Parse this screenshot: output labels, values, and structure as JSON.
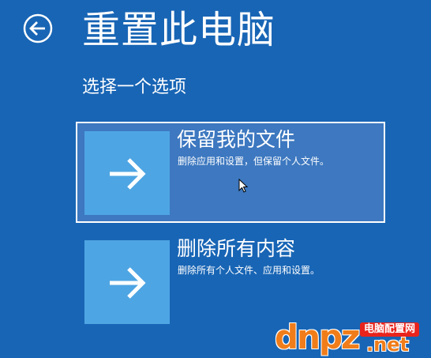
{
  "page": {
    "title": "重置此电脑",
    "subtitle": "选择一个选项",
    "back_icon": "back-arrow-circle-icon"
  },
  "options": [
    {
      "title": "保留我的文件",
      "description": "删除应用和设置，但保留个人文件。",
      "icon": "arrow-right-icon",
      "selected": true
    },
    {
      "title": "删除所有内容",
      "description": "删除所有个人文件、应用和设置。",
      "icon": "arrow-right-icon",
      "selected": false
    }
  ],
  "watermark": {
    "logo_text": "dnpz",
    "tag_text": "电脑配置网",
    "domain_suffix": ".net"
  },
  "colors": {
    "background": "#1865b5",
    "selected_background": "#3d78c0",
    "tile": "#4ea5e3",
    "text": "#ffffff",
    "watermark_orange": "#f07d1a",
    "watermark_red": "#e8241d"
  }
}
